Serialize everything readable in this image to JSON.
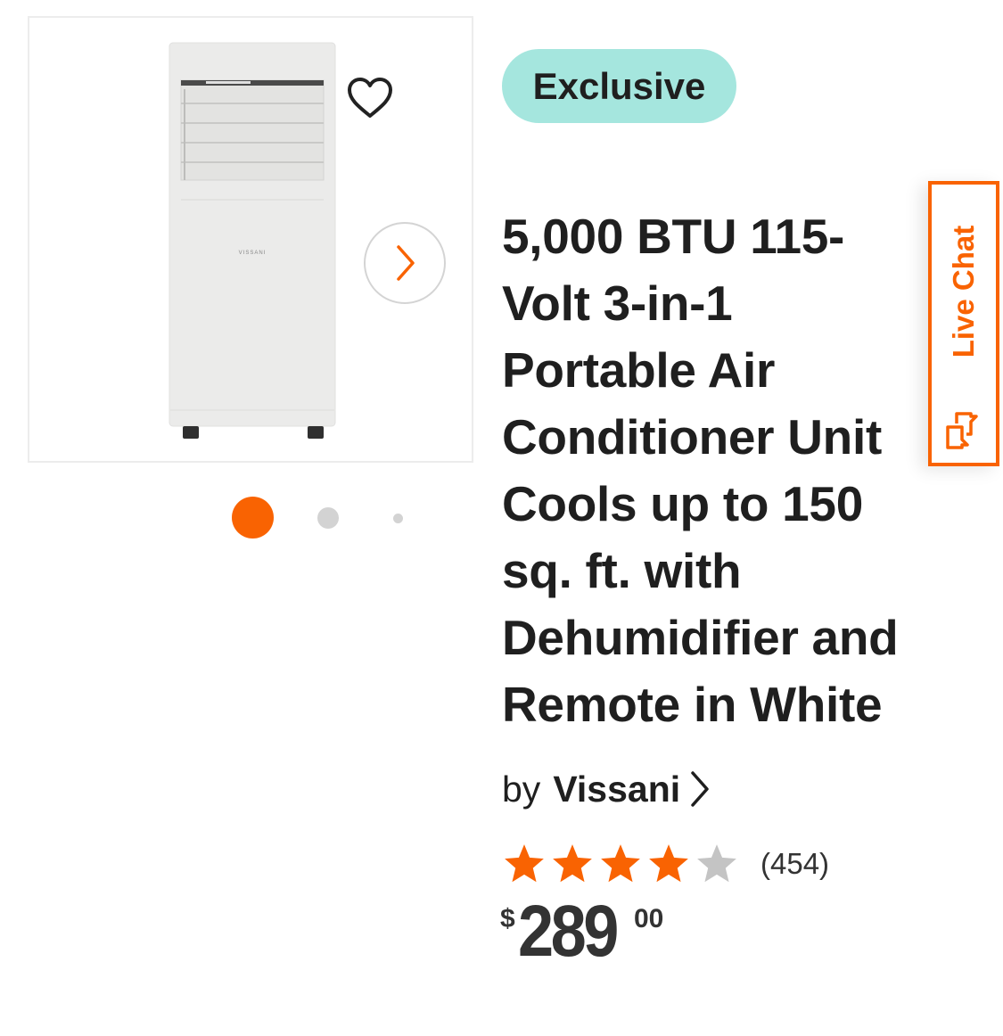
{
  "product": {
    "badge": "Exclusive",
    "title": "5,000 BTU 115-Volt 3-in-1 Portable Air Conditioner Unit Cools up to 150 sq. ft. with Dehumidifier and Remote in White",
    "brand_prefix": "by",
    "brand": "Vissani",
    "image_brand_text": "VISSANI",
    "rating": 4,
    "rating_max": 5,
    "review_count": "(454)",
    "price": {
      "currency": "$",
      "dollars": "289",
      "cents": "00"
    }
  },
  "carousel": {
    "total_dots": 3,
    "active_index": 0
  },
  "live_chat": {
    "label": "Live Chat"
  },
  "icons": {
    "favorite": "heart-outline-icon",
    "next": "chevron-right-icon",
    "chat": "chat-bubbles-icon",
    "brand_link": "chevron-right-icon"
  },
  "colors": {
    "accent": "#f96302",
    "badge_bg": "#a5e6de",
    "star_filled": "#f96302",
    "star_empty": "#c4c4c4",
    "dot_inactive": "#d3d3d3",
    "text": "#1f1f1f"
  }
}
